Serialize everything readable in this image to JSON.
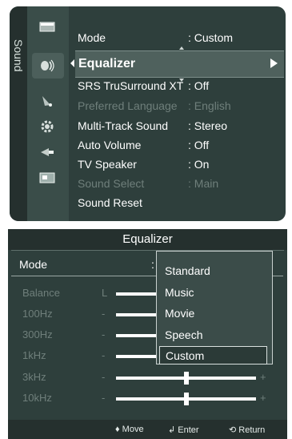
{
  "sound_menu": {
    "tab_label": "Sound",
    "icons": [
      "picture-icon",
      "sound-icon",
      "channel-icon",
      "setup-icon",
      "input-icon",
      "application-icon"
    ],
    "selected": {
      "label": "Equalizer"
    },
    "items": [
      {
        "label": "Mode",
        "value": ": Custom",
        "enabled": true
      },
      {
        "label": "SRS TruSurround XT",
        "value": ": Off",
        "enabled": true
      },
      {
        "label": "Preferred Language",
        "value": ": English",
        "enabled": false
      },
      {
        "label": "Multi-Track Sound",
        "value": ": Stereo",
        "enabled": true
      },
      {
        "label": "Auto Volume",
        "value": ": Off",
        "enabled": true
      },
      {
        "label": "TV Speaker",
        "value": ": On",
        "enabled": true
      },
      {
        "label": "Sound Select",
        "value": ": Main",
        "enabled": false
      },
      {
        "label": "Sound Reset",
        "value": "",
        "enabled": true
      }
    ]
  },
  "equalizer": {
    "title": "Equalizer",
    "mode_label": "Mode",
    "mode_colon": ":",
    "rows": [
      {
        "label": "Balance",
        "left_mark": "L",
        "right_mark": "",
        "level": 0.5
      },
      {
        "label": "100Hz",
        "left_mark": "-",
        "right_mark": "",
        "level": 0.5
      },
      {
        "label": "300Hz",
        "left_mark": "-",
        "right_mark": "",
        "level": 0.5
      },
      {
        "label": "1kHz",
        "left_mark": "-",
        "right_mark": "",
        "level": 0.5
      },
      {
        "label": "3kHz",
        "left_mark": "-",
        "right_mark": "+",
        "level": 0.5
      },
      {
        "label": "10kHz",
        "left_mark": "-",
        "right_mark": "+",
        "level": 0.5
      }
    ],
    "dropdown": {
      "options": [
        "Standard",
        "Music",
        "Movie",
        "Speech",
        "Custom"
      ],
      "selected": "Custom"
    },
    "footer": {
      "move": "♦ Move",
      "enter": "Enter",
      "return": "Return"
    }
  }
}
